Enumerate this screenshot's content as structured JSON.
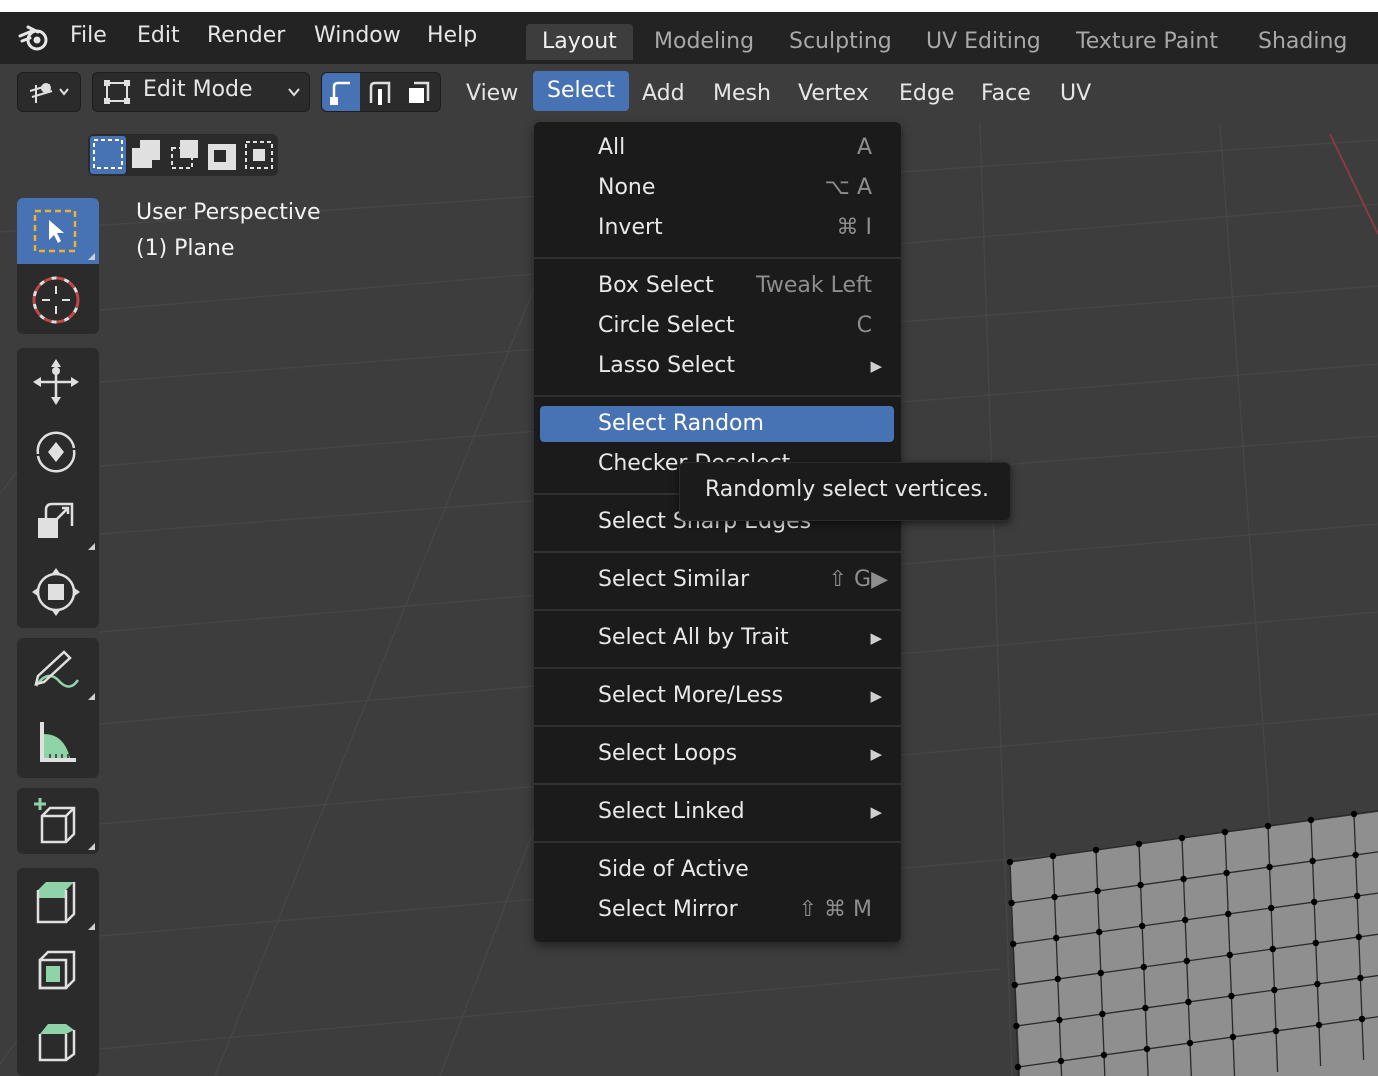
{
  "menubar": {
    "items": [
      "File",
      "Edit",
      "Render",
      "Window",
      "Help"
    ],
    "workspace_tabs": [
      "Layout",
      "Modeling",
      "Sculpting",
      "UV Editing",
      "Texture Paint",
      "Shading"
    ],
    "active_workspace": "Layout"
  },
  "header": {
    "mode": "Edit Mode",
    "menus": [
      "View",
      "Select",
      "Add",
      "Mesh",
      "Vertex",
      "Edge",
      "Face",
      "UV"
    ],
    "active_menu": "Select"
  },
  "viewport": {
    "perspective_label": "User Perspective",
    "object_label": "(1) Plane"
  },
  "select_menu": {
    "items": [
      {
        "label": "All",
        "shortcut": "A"
      },
      {
        "label": "None",
        "shortcut": "⌥ A"
      },
      {
        "label": "Invert",
        "shortcut": "⌘ I"
      },
      {
        "label": "Box Select",
        "shortcut": "Tweak Left"
      },
      {
        "label": "Circle Select",
        "shortcut": "C"
      },
      {
        "label": "Lasso Select",
        "shortcut": "▶"
      },
      {
        "label": "Select Random",
        "shortcut": ""
      },
      {
        "label": "Checker Deselect",
        "shortcut": ""
      },
      {
        "label": "Select Sharp Edges",
        "shortcut": ""
      },
      {
        "label": "Select Similar",
        "shortcut": "⇧ G▶"
      },
      {
        "label": "Select All by Trait",
        "shortcut": "▶"
      },
      {
        "label": "Select More/Less",
        "shortcut": "▶"
      },
      {
        "label": "Select Loops",
        "shortcut": "▶"
      },
      {
        "label": "Select Linked",
        "shortcut": "▶"
      },
      {
        "label": "Side of Active",
        "shortcut": ""
      },
      {
        "label": "Select Mirror",
        "shortcut": "⇧ ⌘ M"
      }
    ],
    "highlighted": "Select Random"
  },
  "tooltip": {
    "text": "Randomly select vertices."
  },
  "colors": {
    "accent": "#4772b3",
    "menu_bg": "#1b1b1b",
    "viewport_bg": "#3d3d3d"
  },
  "icons": [
    "blender-logo-icon",
    "transform-pivot-icon",
    "edit-mode-icon",
    "vertex-select-icon",
    "edge-select-icon",
    "face-select-icon",
    "select-box-icon",
    "cursor-icon",
    "move-icon",
    "rotate-icon",
    "scale-icon",
    "transform-icon",
    "annotate-icon",
    "measure-icon",
    "add-cube-icon",
    "extrude-icon",
    "inset-icon",
    "bevel-icon"
  ]
}
